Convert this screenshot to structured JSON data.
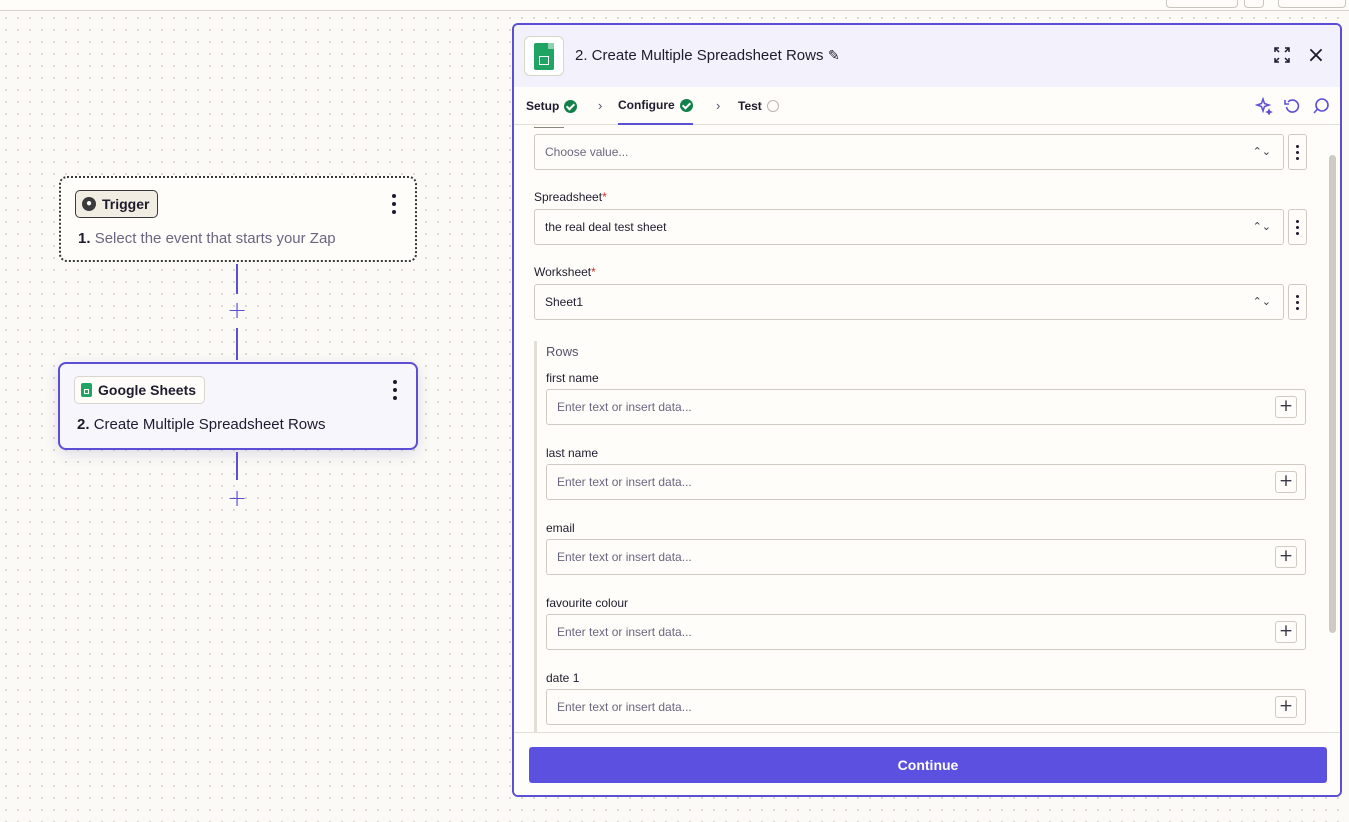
{
  "canvas": {
    "trigger": {
      "chip_label": "Trigger",
      "step_number": "1.",
      "step_text": "Select the event that starts your Zap"
    },
    "action": {
      "chip_label": "Google Sheets",
      "step_number": "2.",
      "step_text": "Create Multiple Spreadsheet Rows"
    }
  },
  "panel": {
    "title": "2. Create Multiple Spreadsheet Rows",
    "tabs": [
      {
        "label": "Setup",
        "status": "complete"
      },
      {
        "label": "Configure",
        "status": "complete"
      },
      {
        "label": "Test",
        "status": "pending"
      }
    ],
    "drive_select": {
      "placeholder": "Choose value..."
    },
    "spreadsheet": {
      "label": "Spreadsheet",
      "required_mark": "*",
      "value": "the real deal test sheet"
    },
    "worksheet": {
      "label": "Worksheet",
      "required_mark": "*",
      "value": "Sheet1"
    },
    "rows": {
      "title": "Rows",
      "fields": [
        {
          "label": "first name",
          "placeholder": "Enter text or insert data..."
        },
        {
          "label": "last name",
          "placeholder": "Enter text or insert data..."
        },
        {
          "label": "email",
          "placeholder": "Enter text or insert data..."
        },
        {
          "label": "favourite colour",
          "placeholder": "Enter text or insert data..."
        },
        {
          "label": "date 1",
          "placeholder": "Enter text or insert data..."
        }
      ]
    },
    "continue_label": "Continue"
  },
  "colors": {
    "accent": "#5b4fd6",
    "button": "#5b50e0",
    "success": "#118049",
    "sheets_green": "#1fa463",
    "required": "#d12e2e"
  },
  "icons": {
    "add": "+",
    "insert": "+",
    "close": "×",
    "pencil": "✎",
    "chevron": "›",
    "updown": "⌃⌄"
  }
}
